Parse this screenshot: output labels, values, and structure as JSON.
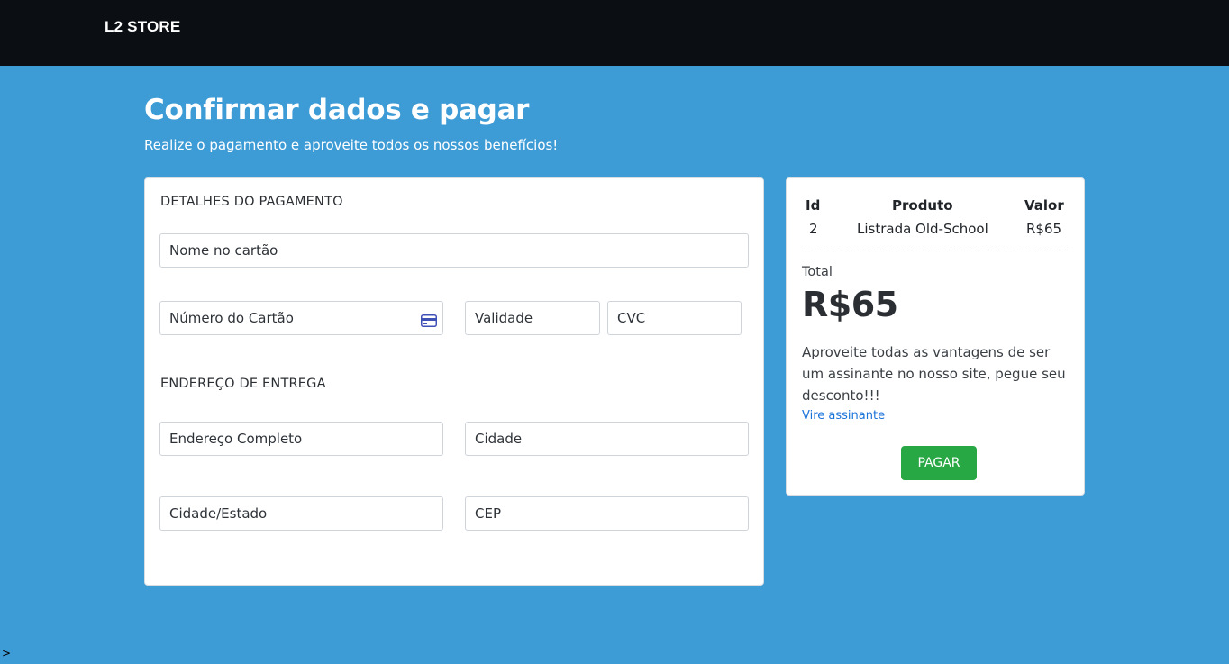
{
  "navbar": {
    "brand": "L2 STORE"
  },
  "header": {
    "title": "Confirmar dados e pagar",
    "subtitle": "Realize o pagamento e aproveite todos os nossos benefícios!"
  },
  "payment": {
    "section_title": "DETALHES DO PAGAMENTO",
    "card_name_placeholder": "Nome no cartão",
    "card_number_placeholder": "Número do Cartão",
    "card_icon": "credit-card-icon",
    "expiry_placeholder": "Validade",
    "cvc_placeholder": "CVC"
  },
  "shipping": {
    "section_title": "ENDEREÇO DE ENTREGA",
    "address_placeholder": "Endereço Completo",
    "city_placeholder": "Cidade",
    "city_state_placeholder": "Cidade/Estado",
    "zip_placeholder": "CEP"
  },
  "summary": {
    "columns": [
      "Id",
      "Produto",
      "Valor"
    ],
    "rows": [
      {
        "id": "2",
        "product": "Listrada Old-School",
        "value": "R$65"
      }
    ],
    "separator": "-----------------------------------------",
    "total_label": "Total",
    "total_value": "R$65",
    "promo_text": "Aproveite todas as vantagens de ser um assinante no nosso site, pegue seu desconto!!!",
    "promo_link": "Vire assinante",
    "pay_button": "PAGAR"
  },
  "colors": {
    "page_background": "#3d9bd6",
    "navbar_background": "#0b0f14",
    "pay_button": "#28a745",
    "link": "#1a73d9"
  },
  "misc": {
    "corner_glyph": ">"
  }
}
